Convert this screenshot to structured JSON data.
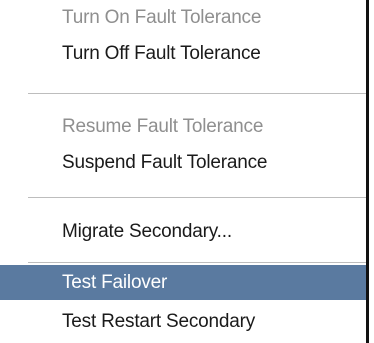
{
  "menu": {
    "items": [
      {
        "label": "Turn On Fault Tolerance",
        "enabled": false,
        "selected": false
      },
      {
        "label": "Turn Off Fault Tolerance",
        "enabled": true,
        "selected": false
      },
      {
        "label": "Resume Fault Tolerance",
        "enabled": false,
        "selected": false
      },
      {
        "label": "Suspend Fault Tolerance",
        "enabled": true,
        "selected": false
      },
      {
        "label": "Migrate Secondary...",
        "enabled": true,
        "selected": false
      },
      {
        "label": "Test Failover",
        "enabled": true,
        "selected": true
      },
      {
        "label": "Test Restart Secondary",
        "enabled": true,
        "selected": false
      }
    ]
  },
  "colors": {
    "highlight": "#5a7aa0",
    "disabled_text": "#8f8f8f",
    "text": "#1a1a1a",
    "separator": "#bdbdbd"
  }
}
